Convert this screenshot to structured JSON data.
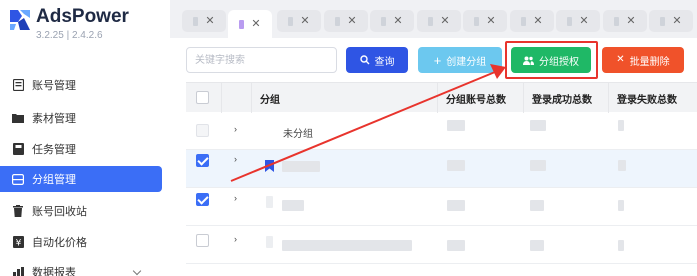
{
  "app": {
    "name": "AdsPower",
    "version": "3.2.25 | 2.4.2.6"
  },
  "sidebar": {
    "items": [
      {
        "label": "账号管理",
        "icon": "account-icon",
        "active": false
      },
      {
        "label": "素材管理",
        "icon": "folder-icon",
        "active": false
      },
      {
        "label": "任务管理",
        "icon": "task-icon",
        "active": false
      },
      {
        "label": "分组管理",
        "icon": "group-icon",
        "active": true
      },
      {
        "label": "账号回收站",
        "icon": "trash-icon",
        "active": false
      },
      {
        "label": "自动化价格",
        "icon": "price-icon",
        "active": false
      },
      {
        "label": "数据报表",
        "icon": "report-icon",
        "active": false
      }
    ]
  },
  "tabs": {
    "close_glyph": "✕",
    "count": 10,
    "active_index": 1
  },
  "toolbar": {
    "search_placeholder": "关键字搜索",
    "query_label": "查询",
    "create_label": "创建分组",
    "auth_label": "分组授权",
    "delete_label": "批量删除"
  },
  "table": {
    "headers": [
      "分组",
      "分组账号总数",
      "登录成功总数",
      "登录失败总数"
    ],
    "ungrouped_label": "未分组",
    "rows": [
      {
        "checked": false,
        "disabled": true
      },
      {
        "checked": true,
        "disabled": false
      },
      {
        "checked": true,
        "disabled": false
      },
      {
        "checked": false,
        "disabled": false
      }
    ]
  },
  "colors": {
    "primary": "#3b6ef6",
    "query": "#2f55e4",
    "create": "#6cc8ef",
    "auth": "#1fb866",
    "delete": "#f0522a",
    "annotation": "#e8342d"
  }
}
